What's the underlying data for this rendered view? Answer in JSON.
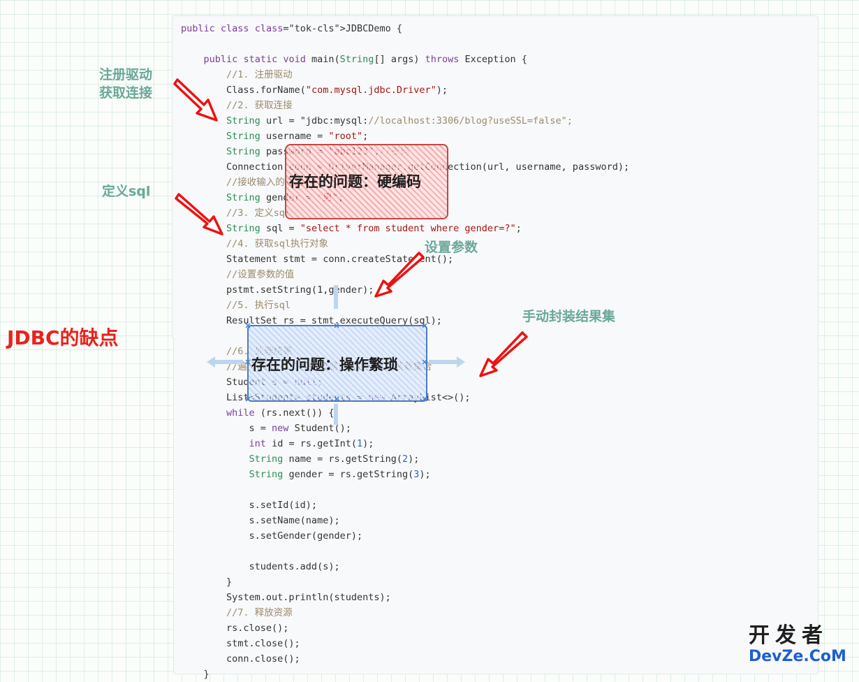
{
  "code_lines": [
    "public class JDBCDemo {",
    "",
    "    public static void main(String[] args) throws Exception {",
    "        //1. 注册驱动",
    "        Class.forName(\"com.mysql.jdbc.Driver\");",
    "        //2. 获取连接",
    "        String url = \"jdbc:mysql://localhost:3306/blog?useSSL=false\";",
    "        String username = \"root\";",
    "        String password = \"abc123\";//密码",
    "        Connection conn = DriverManager.getConnection(url, username, password);",
    "        //接收输入的查询条件",
    "        String gender = \"男\";",
    "        //3. 定义sql",
    "        String sql = \"select * from student where gender=?\";",
    "        //4. 获取sql执行对象",
    "        Statement stmt = conn.createStatement();",
    "        //设置参数的值",
    "        pstmt.setString(1,gender);",
    "        //5. 执行sql",
    "        ResultSet rs = stmt.executeQuery(sql);",
    "",
    "        //6. 处理结果",
    "        //遍历Result，获取数据，封装对象，装载集合",
    "        Student s = null;",
    "        List<Student> students = new ArrayList<>();",
    "        while (rs.next()) {",
    "            s = new Student();",
    "            int id = rs.getInt(1);",
    "            String name = rs.getString(2);",
    "            String gender = rs.getString(3);",
    "",
    "            s.setId(id);",
    "            s.setName(name);",
    "            s.setGender(gender);",
    "",
    "            students.add(s);",
    "        }",
    "        System.out.println(students);",
    "        //7. 释放资源",
    "        rs.close();",
    "        stmt.close();",
    "        conn.close();",
    "    }"
  ],
  "annotations": {
    "register_driver": "注册驱动",
    "get_connection": "获取连接",
    "define_sql": "定义sql",
    "set_params": "设置参数",
    "manual_wrap": "手动封装结果集",
    "title": "JDBC的缺点"
  },
  "problem_boxes": {
    "hardcode": "存在的问题：硬编码",
    "tedious": "存在的问题：操作繁琐"
  },
  "watermark": {
    "line1": "开发者",
    "line2": "DevZe.CoM"
  },
  "colors": {
    "annotation_teal": "#6aa89a",
    "title_red": "#e8231c",
    "arrow_red": "#ee1111",
    "box_red": "#c64545",
    "box_blue": "#4f79c6",
    "watermark_blue": "#1e5fd0"
  }
}
